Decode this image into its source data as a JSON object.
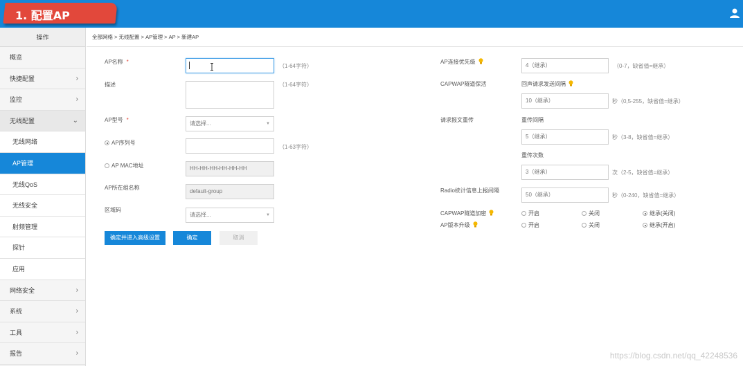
{
  "header": {
    "banner": "1. 配置AP"
  },
  "sidebar": {
    "title": "操作",
    "items": [
      {
        "label": "概览",
        "arrow": ""
      },
      {
        "label": "快捷配置",
        "arrow": "›"
      },
      {
        "label": "监控",
        "arrow": "›"
      },
      {
        "label": "无线配置",
        "arrow": "⌄"
      },
      {
        "label": "无线网络",
        "arrow": ""
      },
      {
        "label": "AP管理",
        "arrow": ""
      },
      {
        "label": "无线QoS",
        "arrow": ""
      },
      {
        "label": "无线安全",
        "arrow": ""
      },
      {
        "label": "射频管理",
        "arrow": ""
      },
      {
        "label": "探针",
        "arrow": ""
      },
      {
        "label": "应用",
        "arrow": ""
      },
      {
        "label": "网络安全",
        "arrow": "›"
      },
      {
        "label": "系统",
        "arrow": "›"
      },
      {
        "label": "工具",
        "arrow": "›"
      },
      {
        "label": "报告",
        "arrow": "›"
      }
    ]
  },
  "breadcrumb": "全部网络 > 无线配置 > AP管理 > AP > 新建AP",
  "form_left": {
    "ap_name_label": "AP名称",
    "required_mark": "*",
    "ap_name_value": "",
    "ap_name_hint": "（1-64字符）",
    "desc_label": "描述",
    "desc_hint": "（1-64字符）",
    "model_label": "AP型号",
    "model_value": "请选择...",
    "serial_label": "AP序列号",
    "serial_hint": "（1-63字符）",
    "mac_label": "AP MAC地址",
    "mac_placeholder": "HH-HH-HH-HH-HH-HH",
    "group_label": "AP所在组名称",
    "group_value": "default-group",
    "region_label": "区域码",
    "region_value": "请选择..."
  },
  "form_right": {
    "priority_label": "AP连接优先级",
    "priority_value": "4（继承）",
    "priority_hint": "（0-7，缺省值=继承）",
    "keepalive_label": "CAPWAP隧道保活",
    "echo_interval_label": "回声请求发送间隔",
    "echo_value": "10（继承）",
    "echo_hint": "秒（0,5-255，缺省值=继承）",
    "retrans_label": "请求报文重传",
    "retrans_interval_label": "重传间隔",
    "retrans_interval_value": "5（继承）",
    "retrans_interval_hint": "秒（3-8，缺省值=继承）",
    "retrans_count_label": "重传次数",
    "retrans_count_value": "3（继承）",
    "retrans_count_hint": "次（2-5，缺省值=继承）",
    "radio_report_label": "Radio统计信息上报间隔",
    "radio_report_value": "50（继承）",
    "radio_report_hint": "秒（0-240，缺省值=继承）",
    "encrypt_label": "CAPWAP隧道加密",
    "encrypt_opts": [
      "开启",
      "关闭",
      "继承(关闭)"
    ],
    "upgrade_label": "AP版本升级",
    "upgrade_opts": [
      "开启",
      "关闭",
      "继承(开启)"
    ]
  },
  "buttons": {
    "advanced": "确定并进入高级设置",
    "ok": "确定",
    "cancel": "取消"
  },
  "watermark": "https://blog.csdn.net/qq_42248536",
  "colors": {
    "brand": "#1687d9",
    "banner": "#e2483b",
    "bulb": "#f5b800"
  }
}
